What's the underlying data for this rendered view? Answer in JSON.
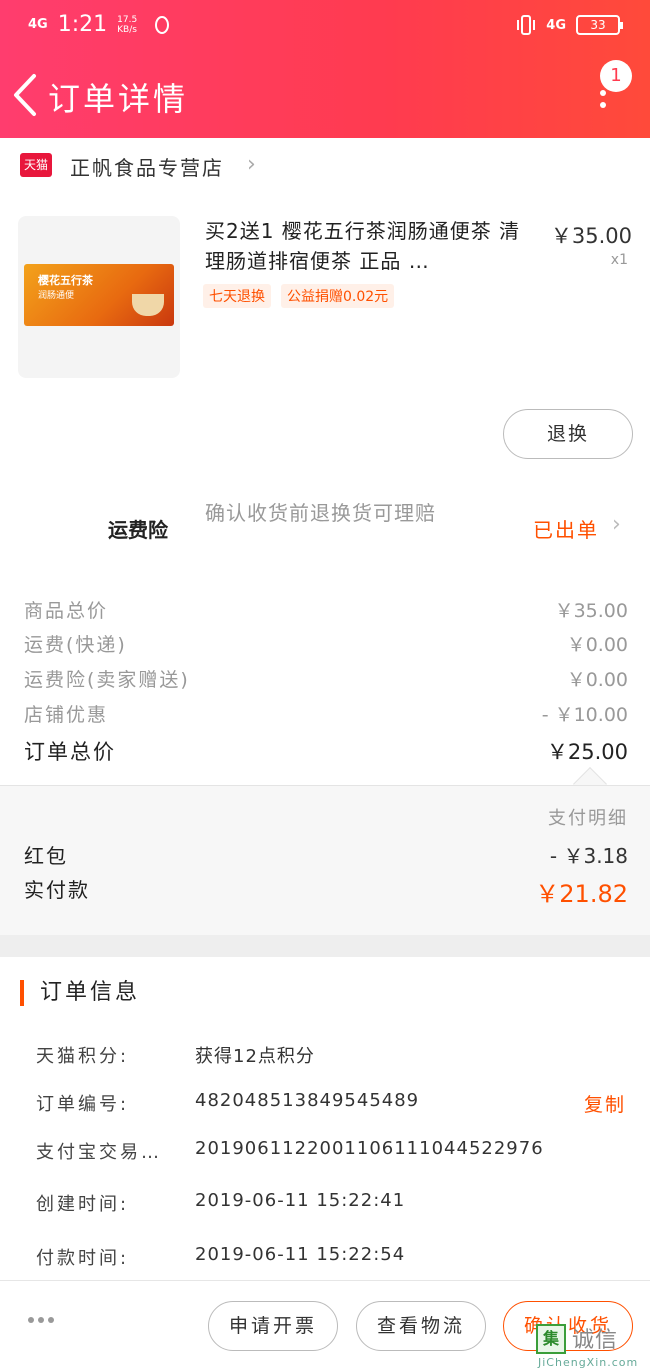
{
  "status_bar": {
    "network_left": "4G",
    "time": "1:21",
    "speed": "17.5 KB/s",
    "network_right": "4G",
    "battery": "33"
  },
  "nav": {
    "title": "订单详情",
    "message_badge": "1"
  },
  "shop": {
    "badge": "天猫",
    "name": "正帆食品专营店"
  },
  "product": {
    "title": "买2送1 樱花五行茶润肠通便茶 清理肠道排宿便茶 正品 …",
    "price": "￥35.00",
    "quantity": "x1",
    "box_text": "樱花五行茶",
    "box_subtext": "润肠通便",
    "tags": [
      "七天退换",
      "公益捐赠0.02元"
    ]
  },
  "refund_button": "退换",
  "insurance": {
    "label": "运费险",
    "description": "确认收货前退换货可理赔",
    "status": "已出单"
  },
  "summary": {
    "rows": [
      {
        "label": "商品总价",
        "value": "￥35.00"
      },
      {
        "label": "运费(快递)",
        "value": "￥0.00"
      },
      {
        "label": "运费险(卖家赠送)",
        "value": "￥0.00"
      },
      {
        "label": "店铺优惠",
        "value": "- ￥10.00"
      }
    ],
    "total_label": "订单总价",
    "total_value": "￥25.00"
  },
  "payment": {
    "detail_link": "支付明细",
    "red_packet_label": "红包",
    "red_packet_value": "- ￥3.18",
    "paid_label": "实付款",
    "paid_value": "￥21.82"
  },
  "order_info": {
    "title": "订单信息",
    "rows": [
      {
        "label": "天猫积分:",
        "value": "获得12点积分"
      },
      {
        "label": "订单编号:",
        "value": "482048513849545489"
      },
      {
        "label": "支付宝交易…",
        "value": "2019061122001106111044522976"
      },
      {
        "label": "创建时间:",
        "value": "2019-06-11 15:22:41"
      },
      {
        "label": "付款时间:",
        "value": "2019-06-11 15:22:54"
      }
    ],
    "copy_label": "复制"
  },
  "bottom_bar": {
    "invoice_button": "申请开票",
    "logistics_button": "查看物流",
    "confirm_button": "确认收货"
  },
  "watermark": {
    "icon": "集",
    "name": "诚信",
    "url": "JiChengXin.com"
  },
  "colors": {
    "header_start": "#ff3d6e",
    "header_end": "#ff4a3a",
    "accent": "#ff5000",
    "tmall_red": "#e8173c"
  }
}
